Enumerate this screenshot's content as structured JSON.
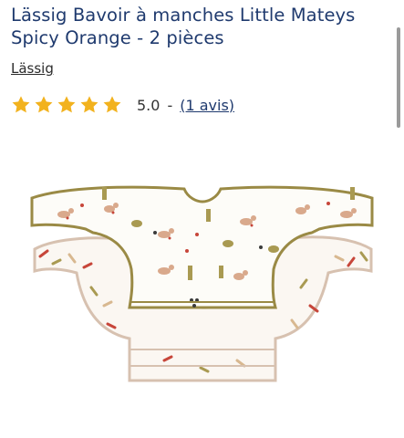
{
  "product": {
    "title": "Lässig Bavoir à manches Little Mateys Spicy Orange - 2 pièces",
    "brand": "Lässig",
    "rating_value": "5.0",
    "rating_separator": "-",
    "reviews_label": "(1 avis)",
    "stars_filled": 5,
    "image_icon": "bib-product-image"
  },
  "colors": {
    "title": "#1f3a6e",
    "star": "#f2b21e",
    "bib_trim_front": "#9a8a45",
    "bib_trim_back": "#d7c1b0",
    "pattern_red": "#c7463a",
    "pattern_olive": "#a99a52"
  }
}
